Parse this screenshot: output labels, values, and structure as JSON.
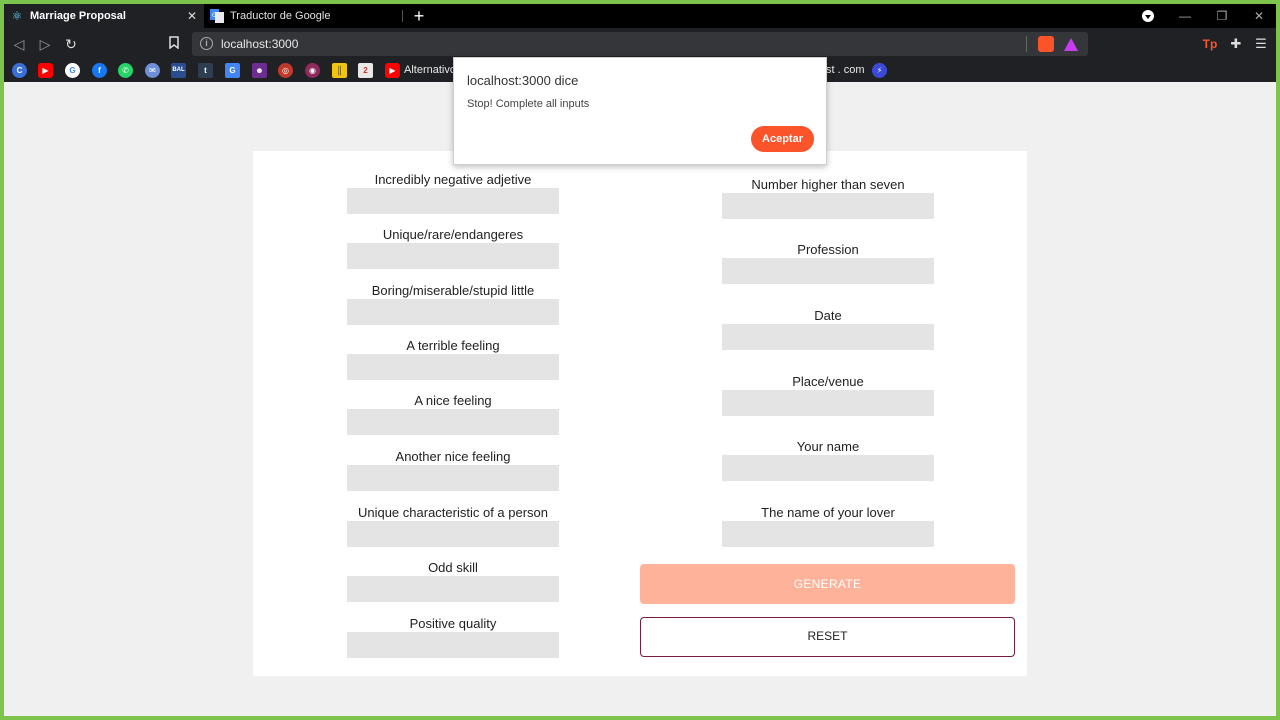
{
  "browser": {
    "tabs": [
      {
        "title": "Marriage Proposal",
        "icon": "react-icon",
        "active": true
      },
      {
        "title": "Traductor de Google",
        "icon": "google-translate-icon",
        "active": false
      }
    ],
    "close_glyph": "✕",
    "newtab_glyph": "+",
    "address": "localhost:3000",
    "bookmarks": {
      "alternativo_label": "Alternativo",
      "partial_label": "st . com"
    }
  },
  "dialog": {
    "title": "localhost:3000 dice",
    "message": "Stop! Complete all inputs",
    "ok_label": "Aceptar"
  },
  "form": {
    "left_fields": [
      {
        "label": "Incredibly negative adjetive"
      },
      {
        "label": "Unique/rare/endangeres"
      },
      {
        "label": "Boring/miserable/stupid little"
      },
      {
        "label": "A terrible feeling"
      },
      {
        "label": "A nice feeling"
      },
      {
        "label": "Another nice feeling"
      },
      {
        "label": "Unique characteristic of a person"
      },
      {
        "label": "Odd skill"
      },
      {
        "label": "Positive quality"
      }
    ],
    "right_fields": [
      {
        "label": "Number higher than seven"
      },
      {
        "label": "Profession"
      },
      {
        "label": "Date"
      },
      {
        "label": "Place/venue"
      },
      {
        "label": "Your name"
      },
      {
        "label": "The name of your lover"
      }
    ],
    "generate_label": "GENERATE",
    "reset_label": "RESET"
  },
  "colors": {
    "accent": "#fb542b",
    "generate_bg": "#ffb29a",
    "reset_border": "#7a1c3c",
    "input_bg": "#e4e4e4"
  }
}
